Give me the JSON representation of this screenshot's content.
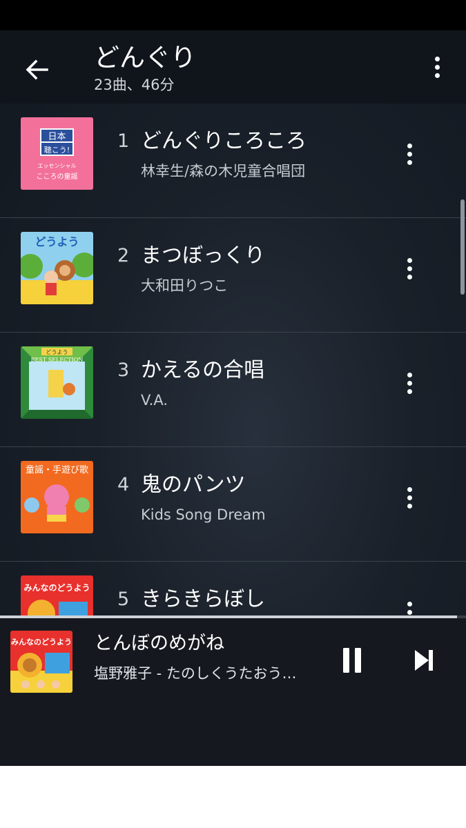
{
  "header": {
    "title": "どんぐり",
    "subtitle": "23曲、46分",
    "back_icon": "arrow-left-icon",
    "more_icon": "more-vertical-icon"
  },
  "tracks": [
    {
      "number": "1",
      "title": "どんぐりころころ",
      "artist": "林幸生/森の木児童合唱団",
      "cover_icon": "album-cover-japanese-songs"
    },
    {
      "number": "2",
      "title": "まつぼっくり",
      "artist": "大和田りつこ",
      "cover_icon": "album-cover-douyou-bear"
    },
    {
      "number": "3",
      "title": "かえるの合唱",
      "artist": "V.A.",
      "cover_icon": "album-cover-best-selection"
    },
    {
      "number": "4",
      "title": "鬼のパンツ",
      "artist": "Kids Song Dream",
      "cover_icon": "album-cover-oni-kids"
    },
    {
      "number": "5",
      "title": "きらきらぼし",
      "artist": "",
      "cover_icon": "album-cover-minna-no-douyou"
    }
  ],
  "covers": {
    "cover1": {
      "line1": "日本",
      "line2": "聴こう!",
      "line3": "エッセンシャル",
      "line4": "こころの童謡"
    },
    "cover2": {
      "line1": "どうよう"
    },
    "cover3": {
      "line1": "どうよう",
      "line2": "BEST SELECTION"
    },
    "cover4": {
      "line1": "童謡・手遊び歌"
    },
    "cover5": {
      "line1": "みんなのどうよう"
    }
  },
  "player": {
    "title": "とんぼのめがね",
    "artist": "塩野雅子 - たのしくうたおう…",
    "progress": 0.98,
    "pause_icon": "pause-icon",
    "next_icon": "skip-next-icon"
  },
  "colors": {
    "header_bg": "#10151c",
    "player_bg": "#15191f",
    "text_primary": "#ffffff",
    "text_secondary": "#c7ccd2"
  }
}
